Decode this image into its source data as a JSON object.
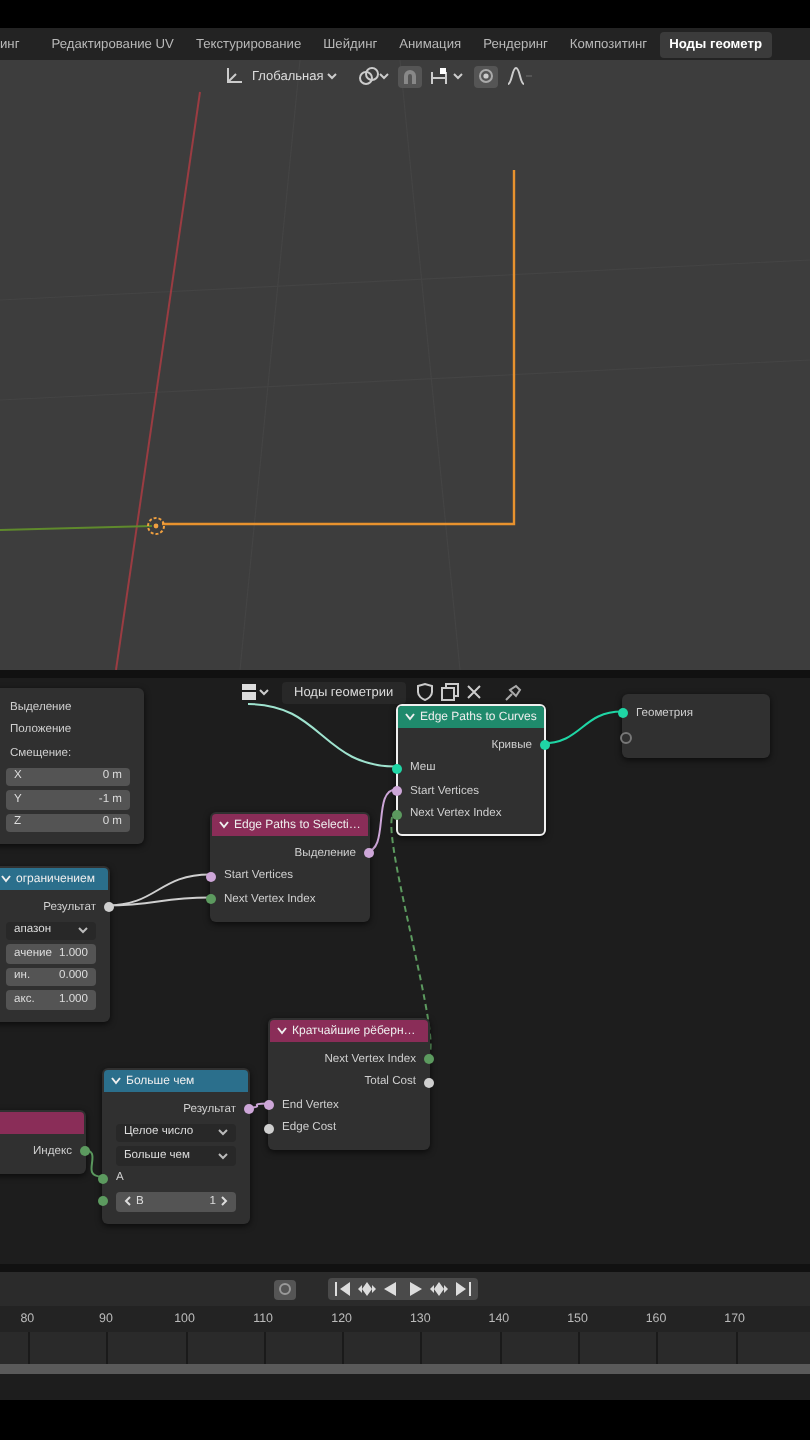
{
  "workspace_tabs": [
    {
      "label": "инг",
      "selected": false
    },
    {
      "label": "Редактирование UV",
      "selected": false
    },
    {
      "label": "Текстурирование",
      "selected": false
    },
    {
      "label": "Шейдинг",
      "selected": false
    },
    {
      "label": "Анимация",
      "selected": false
    },
    {
      "label": "Рендеринг",
      "selected": false
    },
    {
      "label": "Композитинг",
      "selected": false
    },
    {
      "label": "Ноды геометр",
      "selected": true
    }
  ],
  "viewport_header": {
    "orientation": "Глобальная"
  },
  "node_editor": {
    "header": {
      "tree_name": "Ноды геометрии"
    },
    "nodes": [
      {
        "kind": "panel",
        "selected": false,
        "rows": [
          {
            "kind": "label",
            "label": "Выделение"
          },
          {
            "kind": "label",
            "label": "Положение"
          },
          {
            "kind": "label",
            "label": "Смещение:"
          },
          {
            "kind": "value",
            "label": "X",
            "value": "0 m"
          },
          {
            "kind": "value",
            "label": "Y",
            "value": "-1 m"
          },
          {
            "kind": "value",
            "label": "Z",
            "value": "0 m"
          }
        ]
      },
      {
        "kind": "node",
        "title": "ограничением",
        "color": "#2b6f8c",
        "selected": false,
        "rows": [
          {
            "kind": "output",
            "label": "Результат",
            "color": "#cfcfcf"
          },
          {
            "kind": "dropdown",
            "label": "апазон"
          },
          {
            "kind": "value",
            "label": "ачение",
            "value": "1.000"
          },
          {
            "kind": "value",
            "label": "ин.",
            "value": "0.000"
          },
          {
            "kind": "value",
            "label": "акс.",
            "value": "1.000"
          }
        ]
      },
      {
        "kind": "node",
        "title": "Edge Paths to Selecti…",
        "color": "#8a2d58",
        "selected": false,
        "rows": [
          {
            "kind": "output",
            "label": "Выделение",
            "color": "#cda6d8"
          },
          {
            "kind": "input",
            "label": "Start Vertices",
            "color": "#cda6d8"
          },
          {
            "kind": "input",
            "label": "Next Vertex Index",
            "color": "#5c9a5f"
          }
        ]
      },
      {
        "kind": "node",
        "title": "Edge Paths to Curves",
        "color": "#1f8a6c",
        "selected": true,
        "rows": [
          {
            "kind": "output",
            "label": "Кривые",
            "color": "#1fd6a5"
          },
          {
            "kind": "input",
            "label": "Меш",
            "color": "#1fd6a5"
          },
          {
            "kind": "input",
            "label": "Start Vertices",
            "color": "#cda6d8"
          },
          {
            "kind": "input",
            "label": "Next Vertex Index",
            "color": "#5c9a5f"
          }
        ]
      },
      {
        "kind": "panel",
        "selected": false,
        "rows": [
          {
            "kind": "input",
            "label": "Геометрия",
            "color": "#1fd6a5"
          },
          {
            "kind": "empty_socket"
          }
        ]
      },
      {
        "kind": "node",
        "title": "Кратчайшие рёберн…",
        "color": "#8a2d58",
        "selected": false,
        "rows": [
          {
            "kind": "output",
            "label": "Next Vertex Index",
            "color": "#5c9a5f"
          },
          {
            "kind": "output",
            "label": "Total Cost",
            "color": "#cfcfcf"
          },
          {
            "kind": "input",
            "label": "End Vertex",
            "color": "#cda6d8"
          },
          {
            "kind": "input",
            "label": "Edge Cost",
            "color": "#cfcfcf"
          }
        ]
      },
      {
        "kind": "node",
        "color": "#8a2d58",
        "selected": false,
        "rows": [
          {
            "kind": "output",
            "label": "Индекс",
            "color": "#5c9a5f"
          }
        ]
      },
      {
        "kind": "node",
        "title": "Больше чем",
        "color": "#2b6f8c",
        "selected": false,
        "rows": [
          {
            "kind": "output",
            "label": "Результат",
            "color": "#cda6d8"
          },
          {
            "kind": "dropdown",
            "label": "Целое число"
          },
          {
            "kind": "dropdown",
            "label": "Больше чем"
          },
          {
            "kind": "input",
            "label": "A",
            "color": "#5c9a5f"
          },
          {
            "kind": "stepper",
            "label": "B",
            "value": "1",
            "color": "#5c9a5f"
          }
        ]
      }
    ]
  },
  "timeline": {
    "frame_numbers": [
      "80",
      "90",
      "100",
      "110",
      "120",
      "130",
      "140",
      "150",
      "160",
      "170"
    ]
  }
}
